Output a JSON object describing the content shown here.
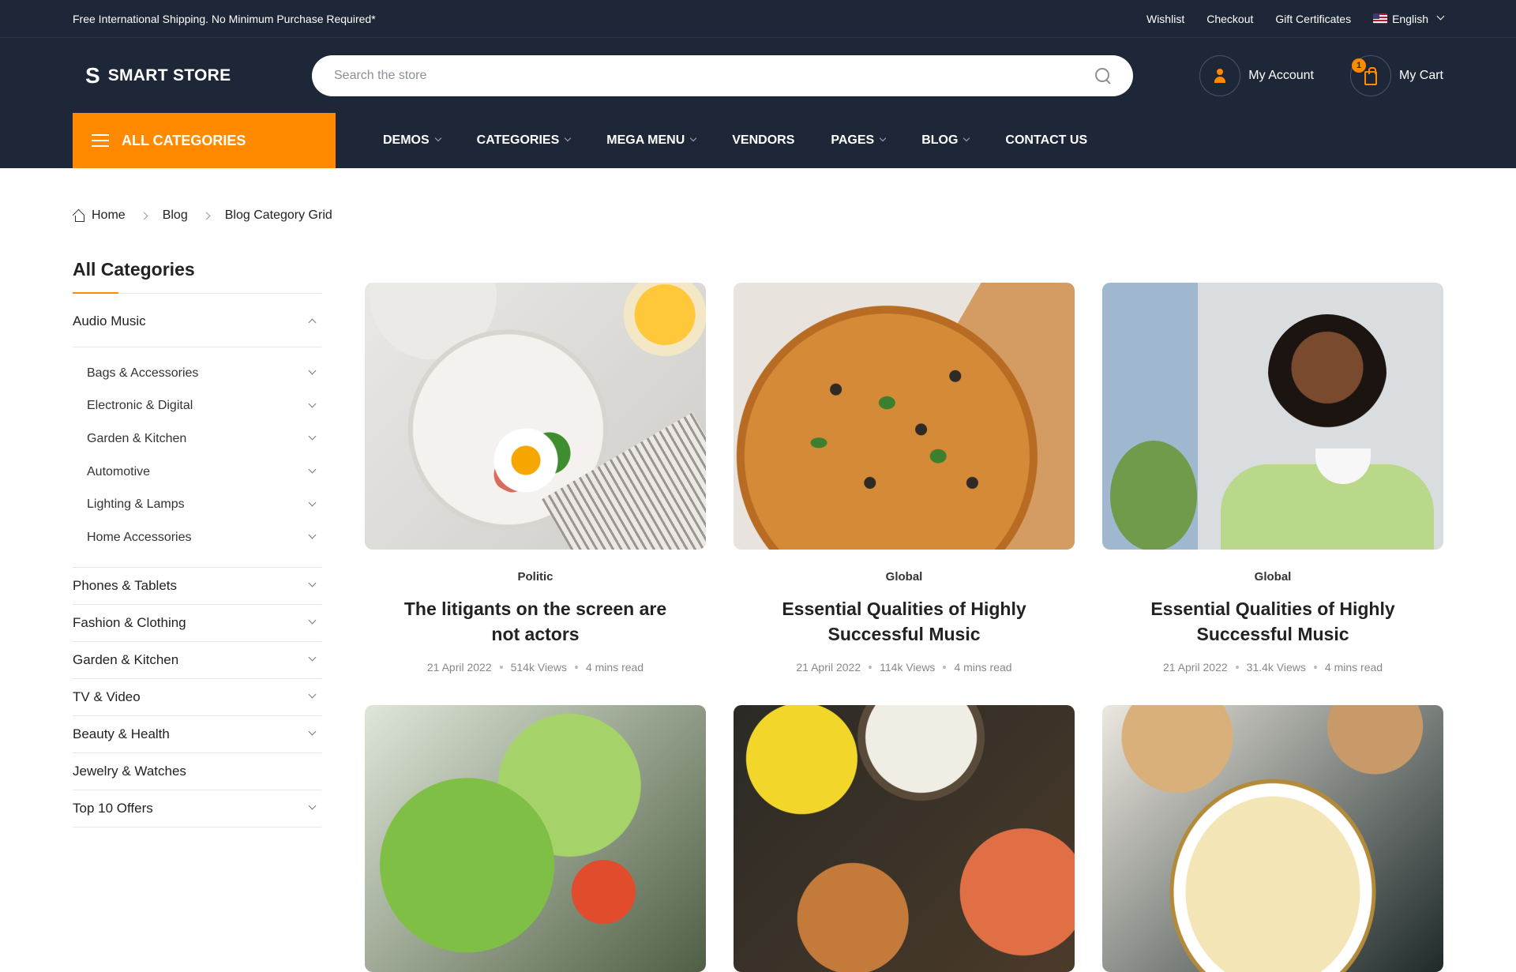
{
  "topbar": {
    "promo": "Free International Shipping. No Minimum Purchase Required*",
    "links": [
      "Wishlist",
      "Checkout",
      "Gift Certificates"
    ],
    "language": "English"
  },
  "header": {
    "logo_mark": "S",
    "logo_text": "SMART STORE",
    "search_placeholder": "Search the store",
    "account_label": "My Account",
    "cart_label": "My Cart",
    "cart_count": "1"
  },
  "nav": {
    "all_categories": "ALL CATEGORIES",
    "items": [
      {
        "label": "DEMOS",
        "dropdown": true
      },
      {
        "label": "CATEGORIES",
        "dropdown": true
      },
      {
        "label": "MEGA MENU",
        "dropdown": true
      },
      {
        "label": "VENDORS",
        "dropdown": false
      },
      {
        "label": "PAGES",
        "dropdown": true
      },
      {
        "label": "BLOG",
        "dropdown": true
      },
      {
        "label": "CONTACT US",
        "dropdown": false
      }
    ]
  },
  "breadcrumb": [
    "Home",
    "Blog",
    "Blog Category Grid"
  ],
  "sidebar": {
    "title": "All Categories",
    "expanded": "Audio Music",
    "subcategories": [
      "Bags & Accessories",
      "Electronic & Digital",
      "Garden & Kitchen",
      "Automotive",
      "Lighting & Lamps",
      "Home Accessories"
    ],
    "categories": [
      {
        "label": "Phones & Tablets",
        "dropdown": true
      },
      {
        "label": "Fashion & Clothing",
        "dropdown": true
      },
      {
        "label": "Garden & Kitchen",
        "dropdown": true
      },
      {
        "label": "TV & Video",
        "dropdown": true
      },
      {
        "label": "Beauty & Health",
        "dropdown": true
      },
      {
        "label": "Jewelry & Watches",
        "dropdown": false
      },
      {
        "label": "Top 10 Offers",
        "dropdown": true
      }
    ]
  },
  "posts": [
    {
      "image": "plated-egg-breakfast",
      "category": "Politic",
      "title": "The litigants on the screen are not actors",
      "date": "21 April 2022",
      "views": "514k Views",
      "read": "4 mins read"
    },
    {
      "image": "pizza-on-board",
      "category": "Global",
      "title": "Essential Qualities of Highly Successful Music",
      "date": "21 April 2022",
      "views": "114k Views",
      "read": "4 mins read"
    },
    {
      "image": "woman-eating-salad",
      "category": "Global",
      "title": "Essential Qualities of Highly Successful Music",
      "date": "21 April 2022",
      "views": "31.4k Views",
      "read": "4 mins read"
    },
    {
      "image": "fresh-salad"
    },
    {
      "image": "roasted-dish-with-sauce"
    },
    {
      "image": "bowl-with-bread"
    }
  ],
  "colors": {
    "accent": "#ff8a00",
    "dark": "#1e2737"
  }
}
